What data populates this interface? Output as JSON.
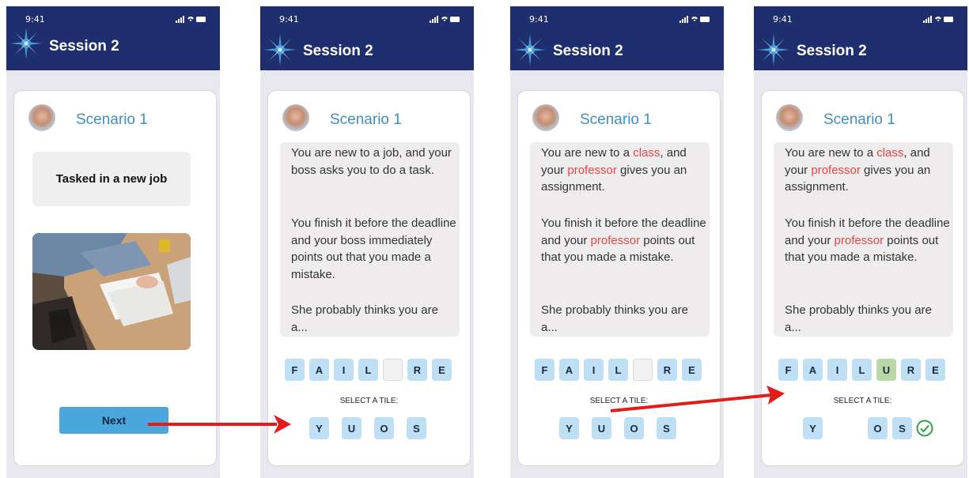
{
  "colors": {
    "header": "#1e2e6e",
    "accent": "#3f8fc0",
    "highlight": "#e04848",
    "tile": "#bfe0f4",
    "tile_correct": "#b8d8a8",
    "arrow": "#e31b1b"
  },
  "status": {
    "time": "9:41"
  },
  "screens": [
    {
      "session_title": "Session 2",
      "scenario_title": "Scenario 1",
      "task": "Tasked in a new job",
      "next_label": "Next"
    },
    {
      "session_title": "Session 2",
      "scenario_title": "Scenario 1",
      "paragraph1": "You are new to a job, and your boss asks you to do a task.",
      "paragraph2": "You finish it before the deadline and your boss immediately points out that you made a mistake.",
      "paragraph3": "She probably thinks you are a...",
      "word_tiles": [
        "F",
        "A",
        "I",
        "L",
        "",
        "R",
        "E"
      ],
      "select_label": "SELECT A TILE:",
      "choice_tiles": [
        "Y",
        "U",
        "O",
        "S"
      ]
    },
    {
      "session_title": "Session 2",
      "scenario_title": "Scenario 1",
      "paragraph1_parts": [
        "You are new to a ",
        "class",
        ", and your ",
        "professor",
        " gives you an assignment."
      ],
      "paragraph2_parts": [
        "You finish it before the deadline and your ",
        "professor",
        " points out that you made a mistake."
      ],
      "paragraph3": "She probably thinks you are a...",
      "word_tiles": [
        "F",
        "A",
        "I",
        "L",
        "",
        "R",
        "E"
      ],
      "select_label": "SELECT A TILE:",
      "choice_tiles": [
        "Y",
        "U",
        "O",
        "S"
      ]
    },
    {
      "session_title": "Session 2",
      "scenario_title": "Scenario 1",
      "paragraph1_parts": [
        "You are new to a ",
        "class",
        ", and your ",
        "professor",
        " gives you an assignment."
      ],
      "paragraph2_parts": [
        "You finish it before the deadline and your ",
        "professor",
        " points out that you made a mistake."
      ],
      "paragraph3": "She probably thinks you are a...",
      "word_tiles": [
        "F",
        "A",
        "I",
        "L",
        "U",
        "R",
        "E"
      ],
      "select_label": "SELECT A TILE:",
      "choice_tiles": [
        "Y",
        "",
        "O",
        "S"
      ],
      "check_icon": "check-circle-icon"
    }
  ]
}
